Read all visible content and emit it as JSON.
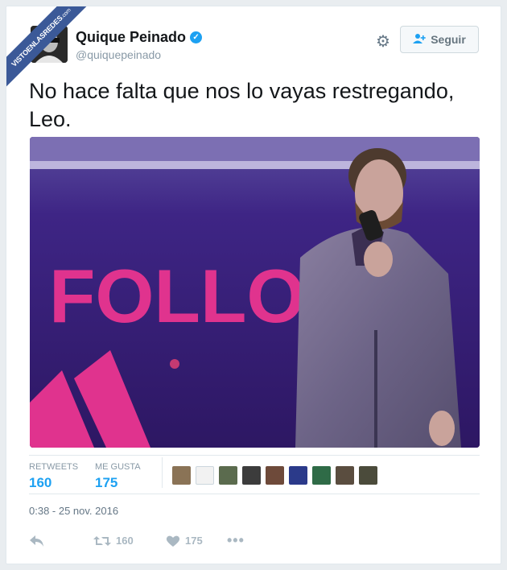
{
  "watermark": {
    "text": "VISTOENLASREDES",
    "sub": ".com"
  },
  "tweet": {
    "author_name": "Quique Peinado",
    "handle": "@quiquepeinado",
    "follow_label": "Seguir",
    "text": "No hace falta que nos lo vayas restregando, Leo.",
    "photo_sign_text": "FOLLO",
    "timestamp": "0:38 - 25 nov. 2016"
  },
  "stats": {
    "retweets_label": "RETWEETS",
    "retweets_value": "160",
    "likes_label": "ME GUSTA",
    "likes_value": "175"
  },
  "actions": {
    "retweet_count": "160",
    "like_count": "175"
  },
  "colors": {
    "accent": "#1da1f2",
    "verified": "#1da1f2",
    "like": "#aab8c2"
  },
  "icons": [
    "verified-badge-icon",
    "gear-icon",
    "follow-person-icon",
    "reply-icon",
    "retweet-icon",
    "heart-icon",
    "more-icon"
  ]
}
